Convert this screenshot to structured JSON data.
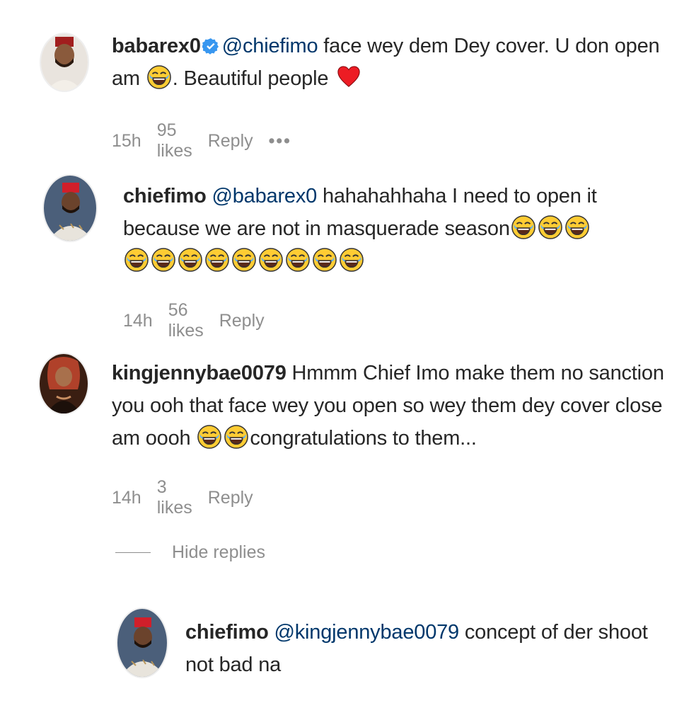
{
  "comments": [
    {
      "username": "babarex0",
      "verified": true,
      "mention": "@chiefimo",
      "text_line1": " face wey dem Dey cover. U don open",
      "text_line2_pre": "am ",
      "text_line2_post": ". Beautiful people ",
      "time": "15h",
      "likes": "95 likes",
      "reply": "Reply",
      "more": "•••"
    },
    {
      "username": "chiefimo",
      "mention": "@babarex0",
      "text_line1": " hahahahhaha I need to open it",
      "text_line2": "because we are not in masquerade season",
      "time": "14h",
      "likes": "56 likes",
      "reply": "Reply"
    },
    {
      "username": "kingjennybae0079",
      "text_line1": " Hmmm Chief Imo make them no sanction",
      "text_line2": "you ooh that face wey you open so wey them dey cover close",
      "text_line3_pre": "am oooh ",
      "text_line3_post": "congratulations to them...",
      "time": "14h",
      "likes": "3 likes",
      "reply": "Reply"
    }
  ],
  "hide_replies": "Hide replies",
  "reply_comment": {
    "username": "chiefimo",
    "mention": "@kingjennybae0079",
    "text_line1": " concept of der shoot",
    "text_line2": "not bad na"
  },
  "icons": {
    "emoji": "face-with-tears-of-joy-icon",
    "heart": "red-heart-icon",
    "verified": "verified-badge-icon"
  },
  "colors": {
    "text": "#262626",
    "mention": "#00376b",
    "meta": "#8e8e8e",
    "verified": "#3897f0",
    "heart": "#ed1c24"
  }
}
